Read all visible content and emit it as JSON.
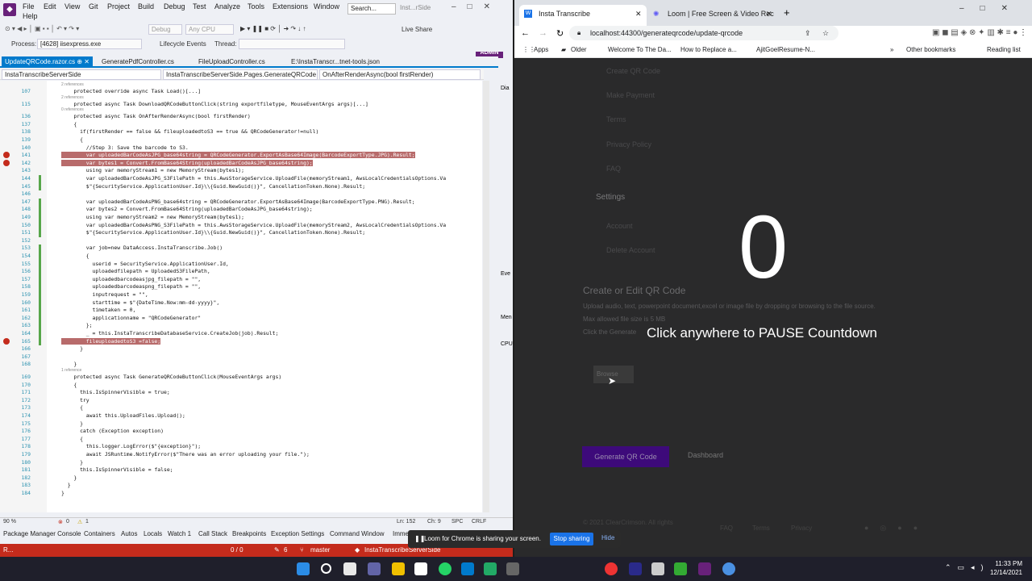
{
  "vs": {
    "menu": [
      "File",
      "Edit",
      "View",
      "Git",
      "Project",
      "Build",
      "Debug",
      "Test",
      "Analyze",
      "Tools",
      "Extensions",
      "Window",
      "Help"
    ],
    "search_placeholder": "Search...",
    "solution": "Inst...rSide",
    "toolbar": {
      "config": "Debug",
      "platform": "Any CPU",
      "live_share": "Live Share",
      "admin": "ADMIN"
    },
    "process": {
      "label": "Process:",
      "value": "[4628] iisexpress.exe",
      "lifecycle": "Lifecycle Events",
      "thread": "Thread:"
    },
    "tabs": [
      "UpdateQRCode.razor.cs",
      "GeneratePdfController.cs",
      "FileUploadController.cs",
      "E:\\InstaTranscr...tnet-tools.json"
    ],
    "nav": [
      "InstaTranscribeServerSide",
      "InstaTranscribeServerSide.Pages.GenerateQRCode",
      "OnAfterRenderAsync(bool firstRender)"
    ],
    "code_lines": [
      {
        "n": "107",
        "t": "    protected override async Task Load()[...]"
      },
      {
        "n": "115",
        "t": "    protected async Task DownloadQRCodeButtonClick(string exportfiletype, MouseEventArgs args)[...]"
      },
      {
        "n": "136",
        "t": "    protected async Task OnAfterRenderAsync(bool firstRender)"
      },
      {
        "n": "137",
        "t": "    {"
      },
      {
        "n": "138",
        "t": "      if(firstRender == false && fileuploadedtoS3 == true && QRCodeGenerator!=null)"
      },
      {
        "n": "139",
        "t": "      {"
      },
      {
        "n": "140",
        "t": "        //Step 3: Save the barcode to S3."
      },
      {
        "n": "141",
        "t": "        var uploadedBarCodeAsJPG_base64string = QRCodeGenerator.ExportAsBase64Image(BarcodeExportType.JPG).Result;"
      },
      {
        "n": "142",
        "t": "        var bytes1 = Convert.FromBase64String(uploadedBarCodeAsJPG_base64string);"
      },
      {
        "n": "143",
        "t": "        using var memoryStream1 = new MemoryStream(bytes1);"
      },
      {
        "n": "144",
        "t": "        var uploadedBarCodeAsJPG_S3FilePath = this.AwsStorageService.UploadFile(memoryStream1, AwsLocalCredentialsOptions.Va"
      },
      {
        "n": "145",
        "t": "        $\"{SecurityService.ApplicationUser.Id}\\\\{Guid.NewGuid()}\", CancellationToken.None).Result;"
      },
      {
        "n": "146",
        "t": ""
      },
      {
        "n": "147",
        "t": "        var uploadedBarCodeAsPNG_base64string = QRCodeGenerator.ExportAsBase64Image(BarcodeExportType.PNG).Result;"
      },
      {
        "n": "148",
        "t": "        var bytes2 = Convert.FromBase64String(uploadedBarCodeAsJPG_base64string);"
      },
      {
        "n": "149",
        "t": "        using var memoryStream2 = new MemoryStream(bytes1);"
      },
      {
        "n": "150",
        "t": "        var uploadedBarCodeAsPNG_S3FilePath = this.AwsStorageService.UploadFile(memoryStream2, AwsLocalCredentialsOptions.Va"
      },
      {
        "n": "151",
        "t": "        $\"{SecurityService.ApplicationUser.Id}\\\\{Guid.NewGuid()}\", CancellationToken.None).Result;"
      },
      {
        "n": "152",
        "t": ""
      },
      {
        "n": "153",
        "t": "        var job=new DataAccess.InstaTranscribe.Job()"
      },
      {
        "n": "154",
        "t": "        {"
      },
      {
        "n": "155",
        "t": "          userid = SecurityService.ApplicationUser.Id,"
      },
      {
        "n": "156",
        "t": "          uploadedfilepath = UploadedS3FilePath,"
      },
      {
        "n": "157",
        "t": "          uploadedbarcodeasjpg_filepath = \"\","
      },
      {
        "n": "158",
        "t": "          uploadedbarcodeaspng_filepath = \"\","
      },
      {
        "n": "159",
        "t": "          inputrequest = \"\","
      },
      {
        "n": "160",
        "t": "          starttime = $\"{DateTime.Now:mm-dd-yyyy}\","
      },
      {
        "n": "161",
        "t": "          timetaken = 0,"
      },
      {
        "n": "162",
        "t": "          applicationname = \"QRCodeGenerator\""
      },
      {
        "n": "163",
        "t": "        };"
      },
      {
        "n": "164",
        "t": "        _ = this.InstaTranscribeDatabaseService.CreateJob(job).Result;"
      },
      {
        "n": "165",
        "t": "        fileuploadedtoS3 =false;"
      },
      {
        "n": "166",
        "t": "      }"
      },
      {
        "n": "167",
        "t": ""
      },
      {
        "n": "168",
        "t": "    }"
      },
      {
        "n": "169",
        "t": "    protected async Task GenerateQRCodeButtonClick(MouseEventArgs args)"
      },
      {
        "n": "170",
        "t": "    {"
      },
      {
        "n": "171",
        "t": "      this.IsSpinnerVisible = true;"
      },
      {
        "n": "172",
        "t": "      try"
      },
      {
        "n": "173",
        "t": "      {"
      },
      {
        "n": "174",
        "t": "        await this.UploadFiles.Upload();"
      },
      {
        "n": "175",
        "t": "      }"
      },
      {
        "n": "176",
        "t": "      catch (Exception exception)"
      },
      {
        "n": "177",
        "t": "      {"
      },
      {
        "n": "178",
        "t": "        this.logger.LogError($\"{exception}\");"
      },
      {
        "n": "179",
        "t": "        await JSRuntime.NotifyError($\"There was an error uploading your file.\");"
      },
      {
        "n": "180",
        "t": "      }"
      },
      {
        "n": "181",
        "t": "      this.IsSpinnerVisible = false;"
      },
      {
        "n": "182",
        "t": "    }"
      },
      {
        "n": "183",
        "t": "  }"
      },
      {
        "n": "184",
        "t": "}"
      }
    ],
    "refs": {
      "r1": "2 references",
      "r2": "2 references",
      "r3": "0 references",
      "r4": "1 reference"
    },
    "status1": {
      "zoom": "90 %",
      "errors": "0",
      "warnings": "1",
      "ln": "Ln: 152",
      "ch": "Ch: 9",
      "spc": "SPC",
      "crlf": "CRLF"
    },
    "bottom_tabs": [
      "Package Manager Console",
      "Containers",
      "Autos",
      "Locals",
      "Watch 1",
      "Call Stack",
      "Breakpoints",
      "Exception Settings",
      "Command Window",
      "Imme"
    ],
    "status2": {
      "ready": "R...",
      "counts": "0 / 0",
      "pen": "6",
      "branch": "master",
      "project": "InstaTranscribeServerSide"
    },
    "side": [
      "Dia",
      "Eve",
      "Men",
      "CPU"
    ]
  },
  "chrome": {
    "tabs": [
      {
        "title": "Insta Transcribe"
      },
      {
        "title": "Loom | Free Screen & Video Rec"
      }
    ],
    "url": "localhost:44300/generateqrcode/update-qrcode",
    "bookmarks": [
      "Apps",
      "Older",
      "Welcome To The Da...",
      "How to Replace a...",
      "AjitGoelResume-N...",
      "Other bookmarks",
      "Reading list"
    ],
    "page": {
      "menu": [
        "Create QR Code",
        "Make Payment",
        "Terms",
        "Privacy Policy",
        "FAQ",
        "Settings",
        "Account",
        "Delete Account"
      ],
      "heading": "Create or Edit QR Code",
      "desc1": "Upload audio, text, powerpoint document,excel or image file by dropping or browsing to the file source.",
      "desc2": "Max allowed file size is 5 MB",
      "desc3": "Click the Generate",
      "browse": "Browse",
      "gen_button": "Generate QR Code",
      "dashboard": "Dashboard",
      "footer": "© 2021 ClearCrimson. All rights",
      "footer_links": [
        "FAQ",
        "Terms",
        "Privacy"
      ]
    },
    "countdown": "0",
    "pause_text": "Click anywhere to PAUSE Countdown"
  },
  "share": {
    "text": "Loom for Chrome is sharing your screen.",
    "stop": "Stop sharing",
    "hide": "Hide"
  },
  "taskbar": {
    "time": "11:33 PM",
    "date": "12/14/2021"
  }
}
